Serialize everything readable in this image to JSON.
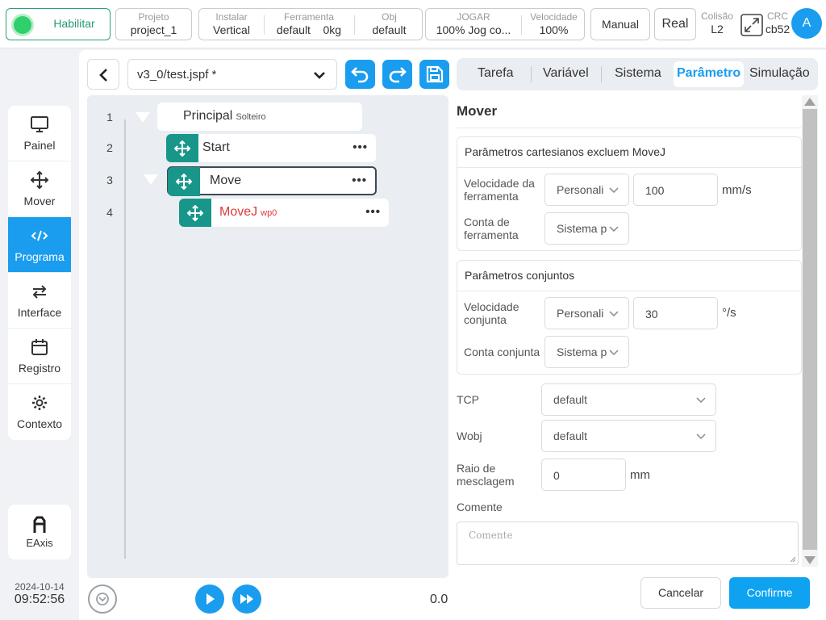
{
  "topbar": {
    "enable": {
      "label": "Habilitar"
    },
    "project": {
      "label": "Projeto",
      "value": "project_1"
    },
    "install": {
      "label": "Instalar",
      "value": "Vertical"
    },
    "tool": {
      "label": "Ferramenta",
      "value": "default",
      "payload": "0kg"
    },
    "obj": {
      "label": "Obj",
      "value": "default"
    },
    "play": {
      "label": "JOGAR",
      "value": "100%  Jog co..."
    },
    "speed": {
      "label": "Velocidade",
      "value": "100%"
    },
    "mode_button": "Manual",
    "real_button": "Real",
    "collision": {
      "label": "Colisão",
      "value": "L2"
    },
    "crc": {
      "label": "CRC",
      "value": "cb52"
    },
    "avatar": "A"
  },
  "rail": {
    "items": [
      {
        "label": "Painel",
        "icon": "monitor-icon"
      },
      {
        "label": "Mover",
        "icon": "move-arrows-icon"
      },
      {
        "label": "Programa",
        "icon": "code-icon",
        "active": true
      },
      {
        "label": "Interface",
        "icon": "swap-arrows-icon"
      },
      {
        "label": "Registro",
        "icon": "calendar-icon"
      },
      {
        "label": "Contexto",
        "icon": "gear-icon"
      }
    ],
    "eaxis": {
      "label": "EAxis",
      "icon": "robot-arm-icon"
    },
    "date": "2024-10-14",
    "time": "09:52:56"
  },
  "editor": {
    "file_name": "v3_0/test.jspf *",
    "lines": [
      {
        "no": "1",
        "text": "Principal",
        "sub": "Solteiro"
      },
      {
        "no": "2",
        "text": "Start"
      },
      {
        "no": "3",
        "text": "Move"
      },
      {
        "no": "4",
        "text": "MoveJ",
        "sub": "wp0"
      }
    ],
    "more": "•••",
    "speed_value": "0.0"
  },
  "tabs": [
    "Tarefa",
    "Variável",
    "Sistema",
    "Parâmetro",
    "Simulação"
  ],
  "panel": {
    "title": "Mover",
    "cartesian": {
      "header": "Parâmetros cartesianos excluem MoveJ",
      "tool_speed_label": "Velocidade da ferramenta",
      "tool_speed_mode": "Personali",
      "tool_speed_value": "100",
      "tool_speed_unit": "mm/s",
      "tool_account_label": "Conta de ferramenta",
      "tool_account_value": "Sistema p"
    },
    "joint": {
      "header": "Parâmetros conjuntos",
      "joint_speed_label": "Velocidade conjunta",
      "joint_speed_mode": "Personali",
      "joint_speed_value": "30",
      "joint_speed_unit": "°/s",
      "joint_account_label": "Conta conjunta",
      "joint_account_value": "Sistema p"
    },
    "tcp_label": "TCP",
    "tcp_value": "default",
    "wobj_label": "Wobj",
    "wobj_value": "default",
    "blend_label": "Raio de mesclagem",
    "blend_value": "0",
    "blend_unit": "mm",
    "comment_label": "Comente",
    "comment_placeholder": "Comente",
    "cancel": "Cancelar",
    "confirm": "Confirme"
  },
  "colors": {
    "accent": "#1a9dee",
    "teal": "#19968a",
    "danger": "#e0393e",
    "enabled": "#2ed06c"
  }
}
